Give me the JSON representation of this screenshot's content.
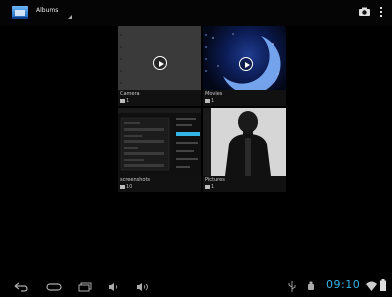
{
  "action_bar": {
    "title": "Albums",
    "app_icon": "gallery-icon",
    "camera_icon": "camera-icon",
    "overflow_icon": "overflow-menu-icon"
  },
  "albums": [
    {
      "name": "Camera",
      "count": "1",
      "type": "video"
    },
    {
      "name": "Movies",
      "count": "1",
      "type": "video"
    },
    {
      "name": "screenshots",
      "count": "10",
      "type": "image"
    },
    {
      "name": "Pictures",
      "count": "1",
      "type": "image"
    }
  ],
  "nav_bar": {
    "icons": [
      "back-icon",
      "home-icon",
      "recents-icon",
      "volume-down-icon",
      "volume-up-icon"
    ]
  },
  "status_bar": {
    "time": "09:10",
    "icons": [
      "usb-icon",
      "android-debug-icon",
      "wifi-icon",
      "battery-icon"
    ],
    "accent": "#33b5e5"
  }
}
